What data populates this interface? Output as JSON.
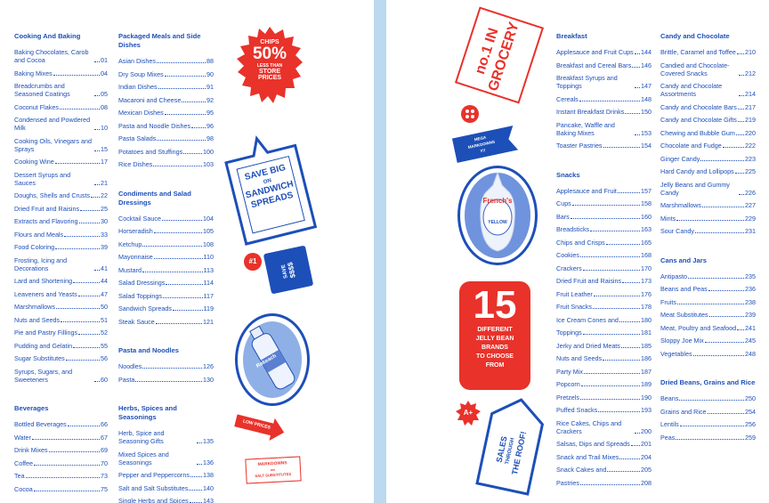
{
  "left_page": {
    "col1": [
      {
        "heading": "Cooking And Baking",
        "items": [
          {
            "label": "Baking Chocolates, Carob and Cocoa",
            "page": "01"
          },
          {
            "label": "Baking Mixes",
            "page": "04"
          },
          {
            "label": "Breadcrumbs and Seasoned Coatings",
            "page": "05"
          },
          {
            "label": "Coconut Flakes",
            "page": "08"
          },
          {
            "label": "Condensed and Powdered Milk",
            "page": "10"
          },
          {
            "label": "Cooking Oils, Vinegars and Sprays",
            "page": "15"
          },
          {
            "label": "Cooking Wine",
            "page": "17"
          },
          {
            "label": "Dessert Syrups and Sauces",
            "page": "21"
          },
          {
            "label": "Doughs, Shells and Crusts",
            "page": "22"
          },
          {
            "label": "Dried Fruit and Raisins",
            "page": "25"
          },
          {
            "label": "Extracts and Flavoring",
            "page": "30"
          },
          {
            "label": "Flours and Meals",
            "page": "33"
          },
          {
            "label": "Food Coloring",
            "page": "39"
          },
          {
            "label": "Frosting, Icing and Decorations",
            "page": "41"
          },
          {
            "label": "Lard and Shortening",
            "page": "44"
          },
          {
            "label": "Leaveners and Yeasts",
            "page": "47"
          },
          {
            "label": "Marshmallows",
            "page": "50"
          },
          {
            "label": "Nuts and Seeds",
            "page": "51"
          },
          {
            "label": "Pie and Pastry Fillings",
            "page": "52"
          },
          {
            "label": "Pudding and Gelatin",
            "page": "55"
          },
          {
            "label": "Sugar Substitutes",
            "page": "56"
          },
          {
            "label": "Syrups, Sugars, and Sweeteners",
            "page": "60"
          }
        ]
      },
      {
        "heading": "Beverages",
        "items": [
          {
            "label": "Bottled Beverages",
            "page": "66"
          },
          {
            "label": "Water",
            "page": "67"
          },
          {
            "label": "Drink Mixes",
            "page": "69"
          },
          {
            "label": "Coffee",
            "page": "70"
          },
          {
            "label": "Tea",
            "page": "73"
          },
          {
            "label": "Cocoa",
            "page": "75"
          }
        ]
      }
    ],
    "col2": [
      {
        "heading": "Packaged Meals and Side Dishes",
        "items": [
          {
            "label": "Asian Dishes",
            "page": "88"
          },
          {
            "label": "Dry Soup Mixes",
            "page": "90"
          },
          {
            "label": "Indian Dishes",
            "page": "91"
          },
          {
            "label": "Macaroni and Cheese",
            "page": "92"
          },
          {
            "label": "Mexican Dishes",
            "page": "95"
          },
          {
            "label": "Pasta and Noodle Dishes",
            "page": "96"
          },
          {
            "label": "Pasta Salads",
            "page": "98"
          },
          {
            "label": "Potatoes and Stuffings",
            "page": "100"
          },
          {
            "label": "Rice Dishes",
            "page": "103"
          }
        ]
      },
      {
        "heading": "Condiments and Salad Dressings",
        "items": [
          {
            "label": "Cocktail Sauce",
            "page": "104"
          },
          {
            "label": "Horseradish",
            "page": "105"
          },
          {
            "label": "Ketchup",
            "page": "108"
          },
          {
            "label": "Mayonnaise",
            "page": "110"
          },
          {
            "label": "Mustard",
            "page": "113"
          },
          {
            "label": "Salad Dressings",
            "page": "114"
          },
          {
            "label": "Salad Toppings",
            "page": "117"
          },
          {
            "label": "Sandwich Spreads",
            "page": "119"
          },
          {
            "label": "Steak Sauce",
            "page": "121"
          }
        ]
      },
      {
        "heading": "Pasta and Noodles",
        "items": [
          {
            "label": "Noodles",
            "page": "126"
          },
          {
            "label": "Pasta",
            "page": "130"
          }
        ]
      },
      {
        "heading": "Herbs, Spices and Seasonings",
        "items": [
          {
            "label": "Herb, Spice and Seasoning Gifts",
            "page": "135"
          },
          {
            "label": "Mixed Spices and Seasonings",
            "page": "136"
          },
          {
            "label": "Pepper and Peppercorns",
            "page": "138"
          },
          {
            "label": "Salt and Salt Substitutes",
            "page": "140"
          },
          {
            "label": "Single Herbs and Spices",
            "page": "143"
          }
        ]
      }
    ],
    "stickers": {
      "chips_top": "CHIPS",
      "chips_pct": "50%",
      "chips_less": "LESS THAN",
      "chips_store": "STORE",
      "chips_prices": "PRICES",
      "spread_1": "SAVE BIG",
      "spread_2": "ON",
      "spread_3": "SANDWICH",
      "spread_4": "SPREADS",
      "num1": "#1",
      "ticket_save": "SAVE",
      "ticket_dollars": "$$$$",
      "bottle_brand": "Rokeach",
      "low_prices": "LOW PRICES",
      "markdowns_1": "MARKDOWNS",
      "markdowns_2": "on",
      "markdowns_3": "SALT SUBSTITUTES"
    }
  },
  "right_page": {
    "col1": [
      {
        "heading": "Breakfast",
        "items": [
          {
            "label": "Applesauce and Fruit Cups",
            "page": "144"
          },
          {
            "label": "Breakfast and Cereal Bars",
            "page": "146"
          },
          {
            "label": "Breakfast Syrups and Toppings",
            "page": "147"
          },
          {
            "label": "Cereals",
            "page": "148"
          },
          {
            "label": "Instant Breakfast Drinks",
            "page": "150"
          },
          {
            "label": "Pancake, Waffle and Baking Mixes",
            "page": "153"
          },
          {
            "label": "Toaster Pastries",
            "page": "154"
          }
        ]
      },
      {
        "heading": "Snacks",
        "items": [
          {
            "label": "Applesauce and Fruit",
            "page": "157"
          },
          {
            "label": "Cups",
            "page": "158"
          },
          {
            "label": "Bars",
            "page": "160"
          },
          {
            "label": "Breadsticks",
            "page": "163"
          },
          {
            "label": "Chips and Crisps",
            "page": "165"
          },
          {
            "label": "Cookies",
            "page": "168"
          },
          {
            "label": "Crackers",
            "page": "170"
          },
          {
            "label": "Dried Fruit and Raisins",
            "page": "173"
          },
          {
            "label": "Fruit Leather",
            "page": "176"
          },
          {
            "label": "Fruit Snacks",
            "page": "178"
          },
          {
            "label": "Ice Cream Cones and",
            "page": "180"
          },
          {
            "label": "Toppings",
            "page": "181"
          },
          {
            "label": "Jerky and Dried Meats",
            "page": "185"
          },
          {
            "label": "Nuts and Seeds",
            "page": "186"
          },
          {
            "label": "Party Mix",
            "page": "187"
          },
          {
            "label": "Popcorn",
            "page": "189"
          },
          {
            "label": "Pretzels",
            "page": "190"
          },
          {
            "label": "Puffed Snacks",
            "page": "193"
          },
          {
            "label": "Rice Cakes, Chips and Crackers",
            "page": "200"
          },
          {
            "label": "Salsas, Dips and Spreads",
            "page": "201"
          },
          {
            "label": "Snack and Trail Mixes",
            "page": "204"
          },
          {
            "label": "Snack Cakes and",
            "page": "205"
          },
          {
            "label": "Pastries",
            "page": "208"
          }
        ]
      }
    ],
    "col2": [
      {
        "heading": "Candy and Chocolate",
        "items": [
          {
            "label": "Brittle, Caramel and Toffee",
            "page": "210"
          },
          {
            "label": "Candied and Chocolate-Covered Snacks",
            "page": "212"
          },
          {
            "label": "Candy and Chocolate Assortments",
            "page": "214"
          },
          {
            "label": "Candy and Chocolate Bars",
            "page": "217"
          },
          {
            "label": "Candy and Chocolate Gifts",
            "page": "219"
          },
          {
            "label": "Chewing and Bubble Gum",
            "page": "220"
          },
          {
            "label": "Chocolate and Fudge",
            "page": "222"
          },
          {
            "label": "Ginger Candy",
            "page": "223"
          },
          {
            "label": "Hard Candy and Lollipops",
            "page": "225"
          },
          {
            "label": "Jelly Beans and Gummy Candy",
            "page": "226"
          },
          {
            "label": "Marshmallows",
            "page": "227"
          },
          {
            "label": "Mints",
            "page": "229"
          },
          {
            "label": "Sour Candy",
            "page": "231"
          }
        ]
      },
      {
        "heading": "Cans and Jars",
        "items": [
          {
            "label": "Antipasto",
            "page": "235"
          },
          {
            "label": "Beans and Peas",
            "page": "236"
          },
          {
            "label": "Fruits",
            "page": "238"
          },
          {
            "label": "Meat Substitutes",
            "page": "239"
          },
          {
            "label": "Meat, Poultry and Seafood",
            "page": "241"
          },
          {
            "label": "Sloppy Joe Mix",
            "page": "245"
          },
          {
            "label": "Vegetables",
            "page": "248"
          }
        ]
      },
      {
        "heading": "Dried Beans, Grains and Rice",
        "items": [
          {
            "label": "Beans",
            "page": "250"
          },
          {
            "label": "Grains and Rice",
            "page": "254"
          },
          {
            "label": "Lentils",
            "page": "256"
          },
          {
            "label": "Peas",
            "page": "259"
          }
        ]
      }
    ],
    "stickers": {
      "grocery_1": "no.1 IN",
      "grocery_2": "GROCERY",
      "mega_1": "MEGA",
      "mega_2": "MARKDOWNS",
      "mega_3": "!!!!",
      "frenchs_brand": "French's",
      "frenchs_sub": "YELLOW",
      "big_number": "15",
      "jelly_1": "DIFFERENT",
      "jelly_2": "JELLY BEAN",
      "jelly_3": "BRANDS",
      "jelly_4": "TO CHOOSE",
      "jelly_5": "FROM",
      "a_plus": "A+",
      "sales_1": "SALES",
      "sales_2": "THROUGH",
      "sales_3": "THE ROOF!"
    }
  },
  "colors": {
    "blue": "#1d4fb8",
    "red": "#e8322a",
    "background": "#bcd9ef",
    "paper": "#ffffff"
  }
}
